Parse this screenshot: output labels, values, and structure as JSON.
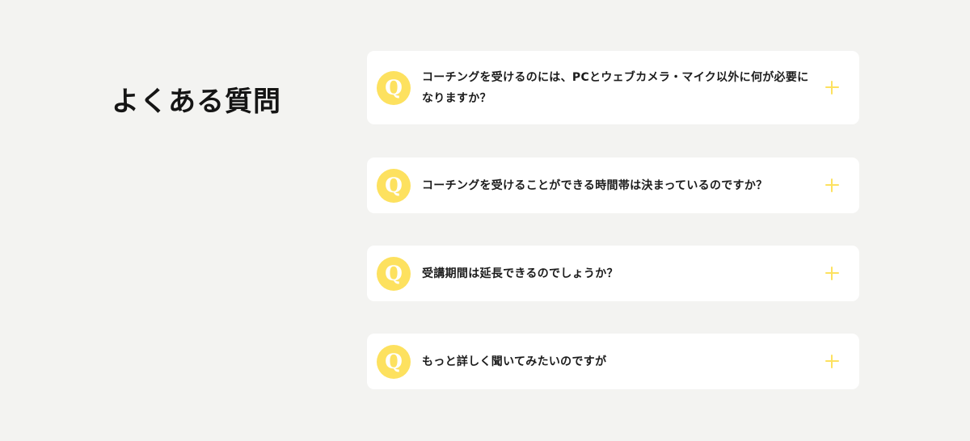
{
  "faq": {
    "title": "よくある質問",
    "q_mark": "Q",
    "accent_color": "#fde15f",
    "items": [
      {
        "question": "コーチングを受けるのには、PCとウェブカメラ・マイク以外に何が必要になりますか？"
      },
      {
        "question": "コーチングを受けることができる時間帯は決まっているのですか？"
      },
      {
        "question": "受講期間は延長できるのでしょうか？"
      },
      {
        "question": "もっと詳しく聞いてみたいのですが"
      }
    ]
  }
}
